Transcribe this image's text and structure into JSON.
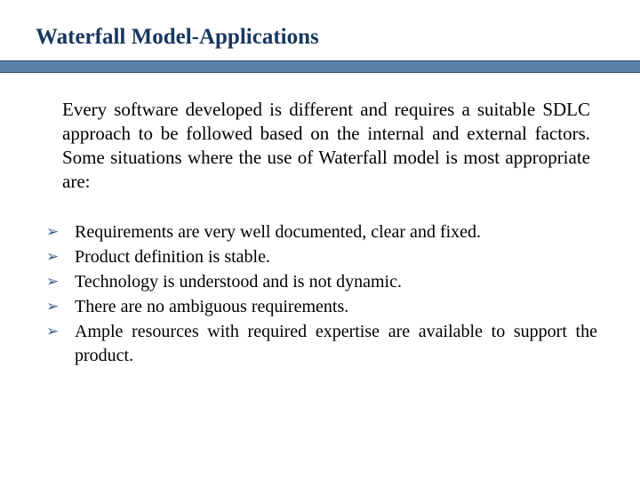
{
  "title": "Waterfall Model-Applications",
  "intro": " Every software developed is different and requires a suitable SDLC approach to be followed based on the internal and external factors. Some situations where the use of Waterfall model is most appropriate are:",
  "bullet": "➢",
  "items": [
    "Requirements are very well documented, clear and fixed.",
    "Product definition is stable.",
    "Technology is understood and is not dynamic.",
    "There are no ambiguous requirements.",
    "Ample resources with required expertise are available to support the product."
  ]
}
